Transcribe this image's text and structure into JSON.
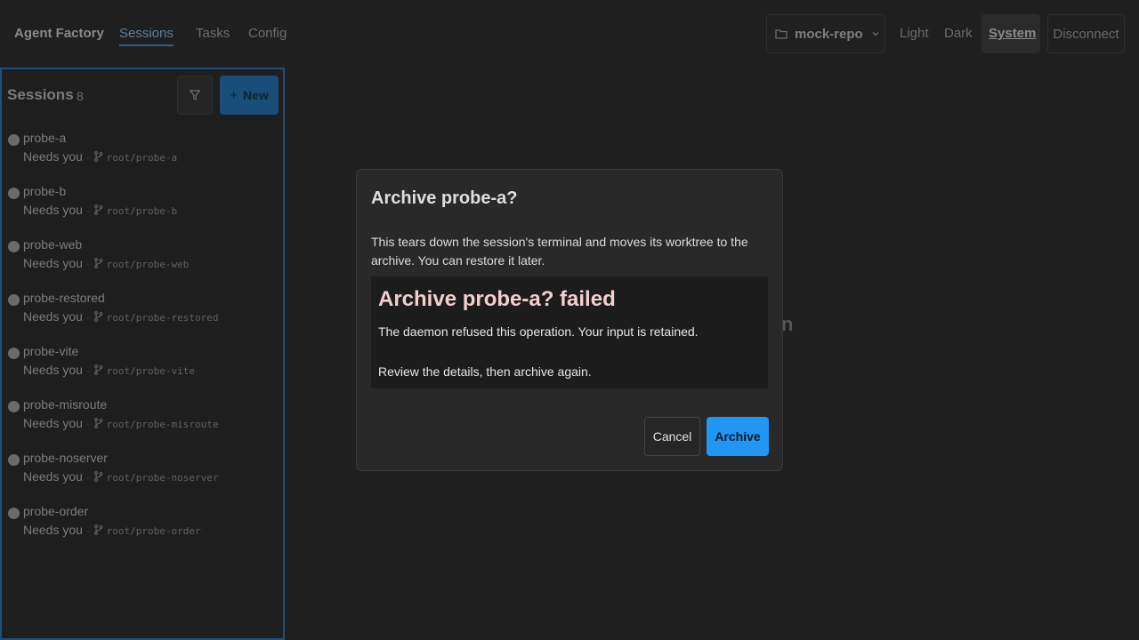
{
  "nav": {
    "brand": "Agent Factory",
    "tabs": [
      {
        "label": "Sessions",
        "active": true
      },
      {
        "label": "Tasks",
        "active": false
      },
      {
        "label": "Config",
        "active": false
      }
    ],
    "repo": "mock-repo",
    "theme_options": [
      "Light",
      "Dark",
      "System"
    ],
    "theme_selected": "System",
    "disconnect_label": "Disconnect"
  },
  "sidebar": {
    "title": "Sessions",
    "count": "8",
    "new_label": "New",
    "sessions": [
      {
        "name": "probe-a",
        "status": "Needs you",
        "branch": "root/probe-a"
      },
      {
        "name": "probe-b",
        "status": "Needs you",
        "branch": "root/probe-b"
      },
      {
        "name": "probe-web",
        "status": "Needs you",
        "branch": "root/probe-web"
      },
      {
        "name": "probe-restored",
        "status": "Needs you",
        "branch": "root/probe-restored"
      },
      {
        "name": "probe-vite",
        "status": "Needs you",
        "branch": "root/probe-vite"
      },
      {
        "name": "probe-misroute",
        "status": "Needs you",
        "branch": "root/probe-misroute"
      },
      {
        "name": "probe-noserver",
        "status": "Needs you",
        "branch": "root/probe-noserver"
      },
      {
        "name": "probe-order",
        "status": "Needs you",
        "branch": "root/probe-order"
      }
    ]
  },
  "background": {
    "partial_text": "n"
  },
  "dialog": {
    "title": "Archive probe-a?",
    "description": "This tears down the session's terminal and moves its worktree to the archive. You can restore it later.",
    "error_title": "Archive probe-a? failed",
    "error_message": "The daemon refused this operation. Your input is retained.",
    "error_hint": "Review the details, then archive again.",
    "cancel_label": "Cancel",
    "archive_label": "Archive"
  },
  "colors": {
    "accent": "#2196f3",
    "background": "#1f1f1f",
    "dialog_bg": "#292929",
    "error_title": "#f2cfcf"
  }
}
